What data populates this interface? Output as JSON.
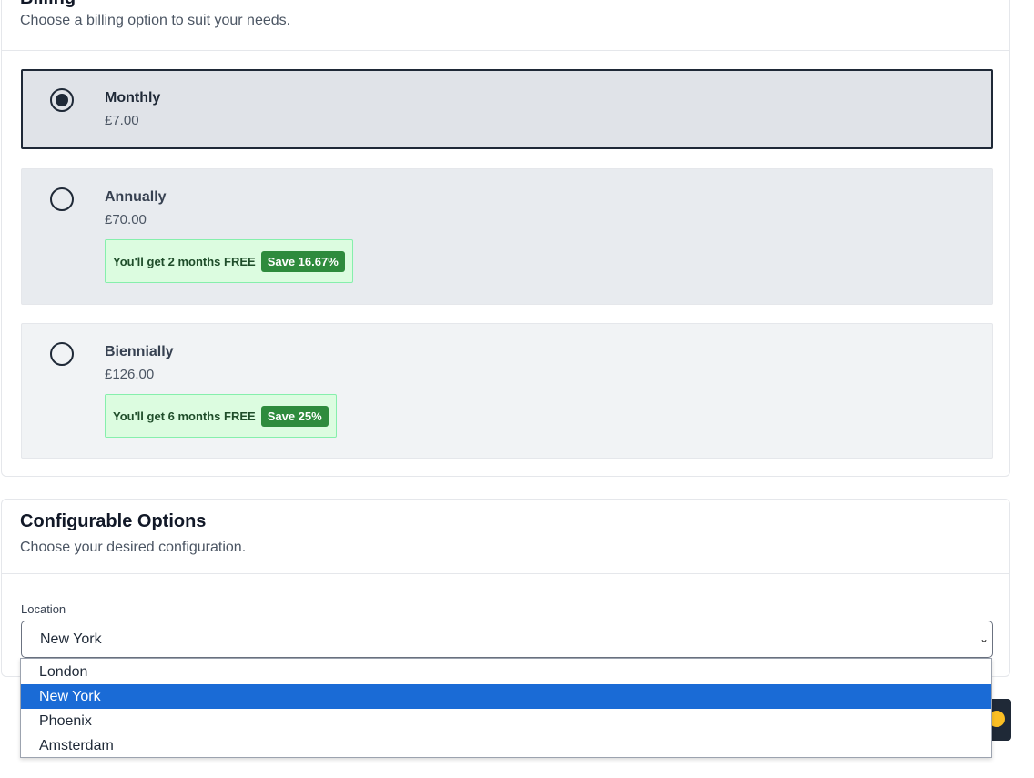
{
  "billing": {
    "title": "Billing",
    "subtitle": "Choose a billing option to suit your needs.",
    "options": [
      {
        "name": "Monthly",
        "price": "£7.00",
        "selected": true
      },
      {
        "name": "Annually",
        "price": "£70.00",
        "promo": "You'll get 2 months FREE",
        "badge": "Save 16.67%"
      },
      {
        "name": "Biennially",
        "price": "£126.00",
        "promo": "You'll get 6 months FREE",
        "badge": "Save 25%"
      }
    ]
  },
  "config": {
    "title": "Configurable Options",
    "subtitle": "Choose your desired configuration.",
    "location_label": "Location",
    "location_value": "New York",
    "location_options": [
      "London",
      "New York",
      "Phoenix",
      "Amsterdam"
    ],
    "selected_index": 1
  },
  "colors": {
    "selected_highlight": "#1a6bd6",
    "badge_green": "#2e8b3d",
    "dark": "#1f2937"
  }
}
